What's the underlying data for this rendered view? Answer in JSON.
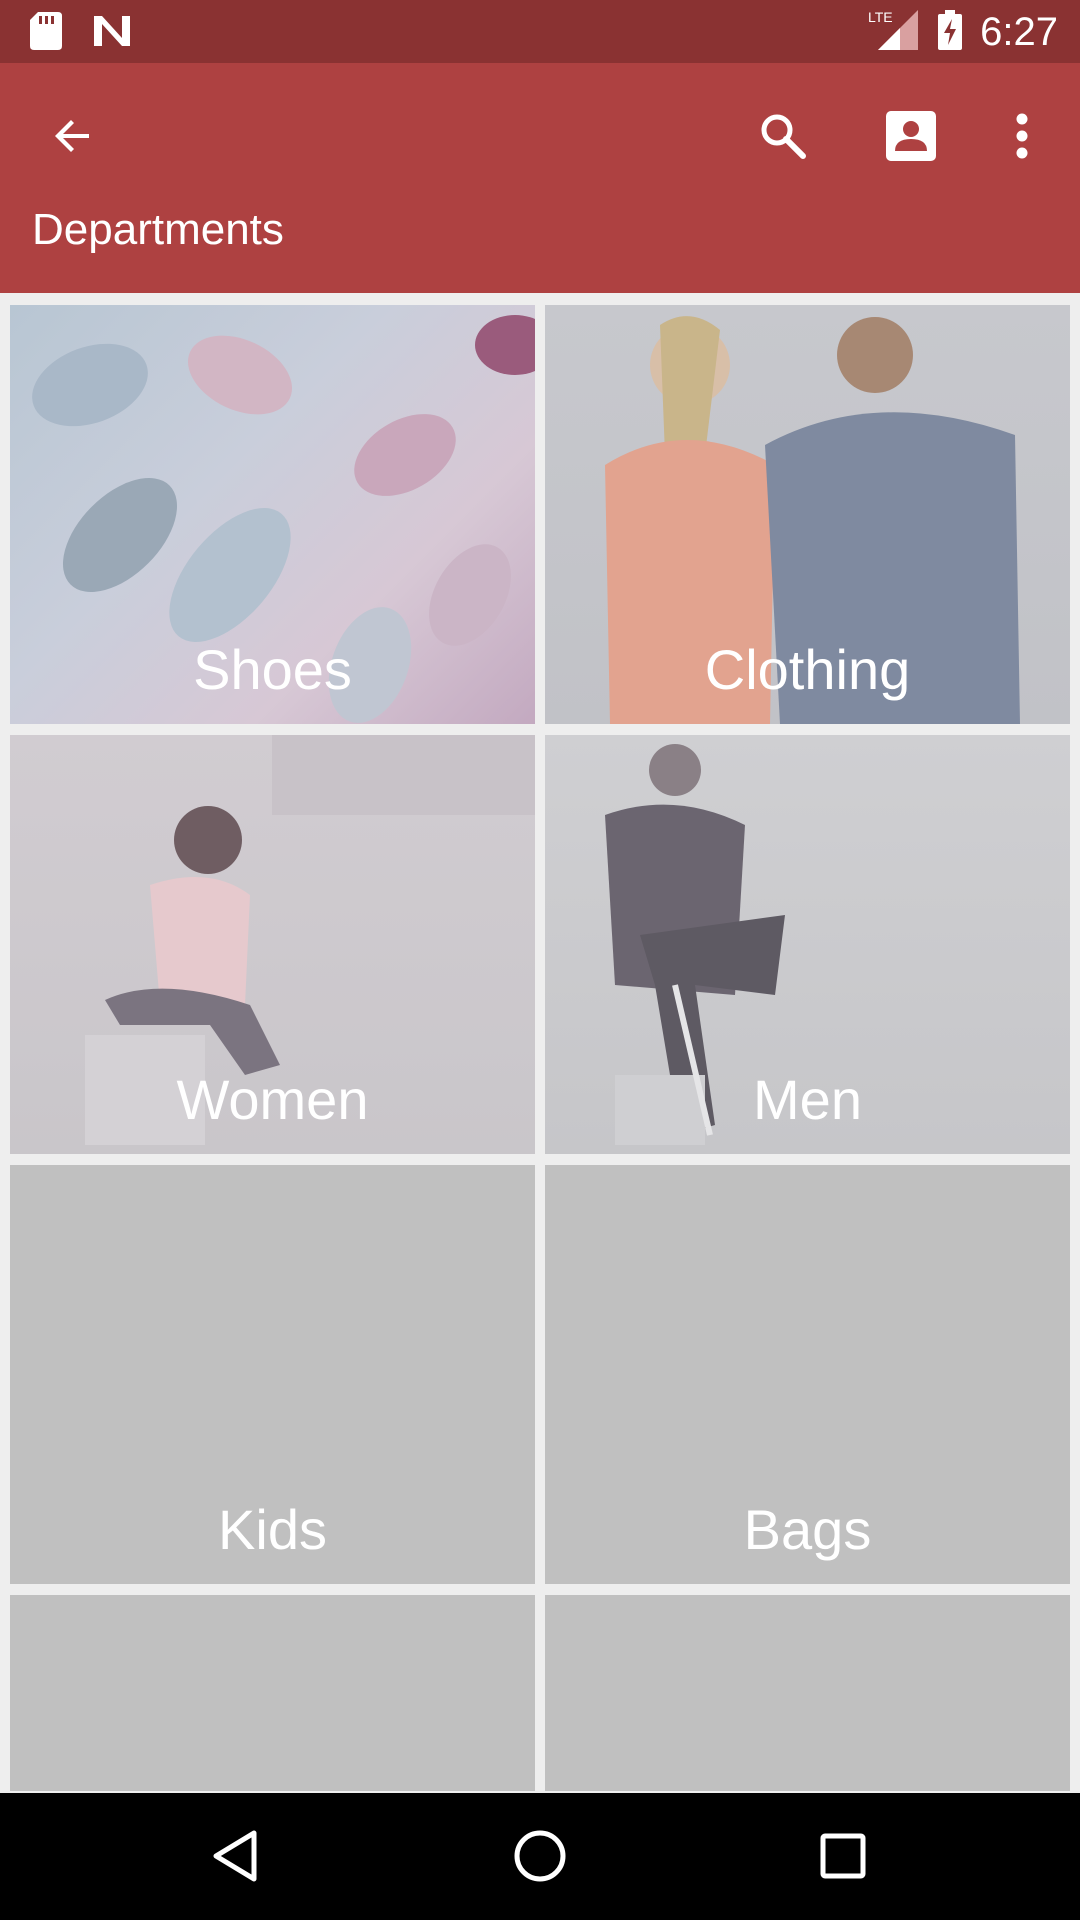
{
  "status_bar": {
    "time": "6:27",
    "network": "LTE",
    "icons": [
      "sd-card-icon",
      "n-notification-icon",
      "lte-signal-icon",
      "battery-charging-icon"
    ]
  },
  "app_bar": {
    "title": "Departments",
    "background": "#ae4141",
    "icons": [
      "back-arrow-icon",
      "search-icon",
      "account-box-icon",
      "more-vert-icon"
    ]
  },
  "departments": [
    {
      "label": "Shoes"
    },
    {
      "label": "Clothing"
    },
    {
      "label": "Women"
    },
    {
      "label": "Men"
    },
    {
      "label": "Kids"
    },
    {
      "label": "Bags"
    },
    {
      "label": ""
    },
    {
      "label": ""
    }
  ],
  "nav_bar": {
    "icons": [
      "nav-back-icon",
      "nav-home-icon",
      "nav-recents-icon"
    ]
  }
}
